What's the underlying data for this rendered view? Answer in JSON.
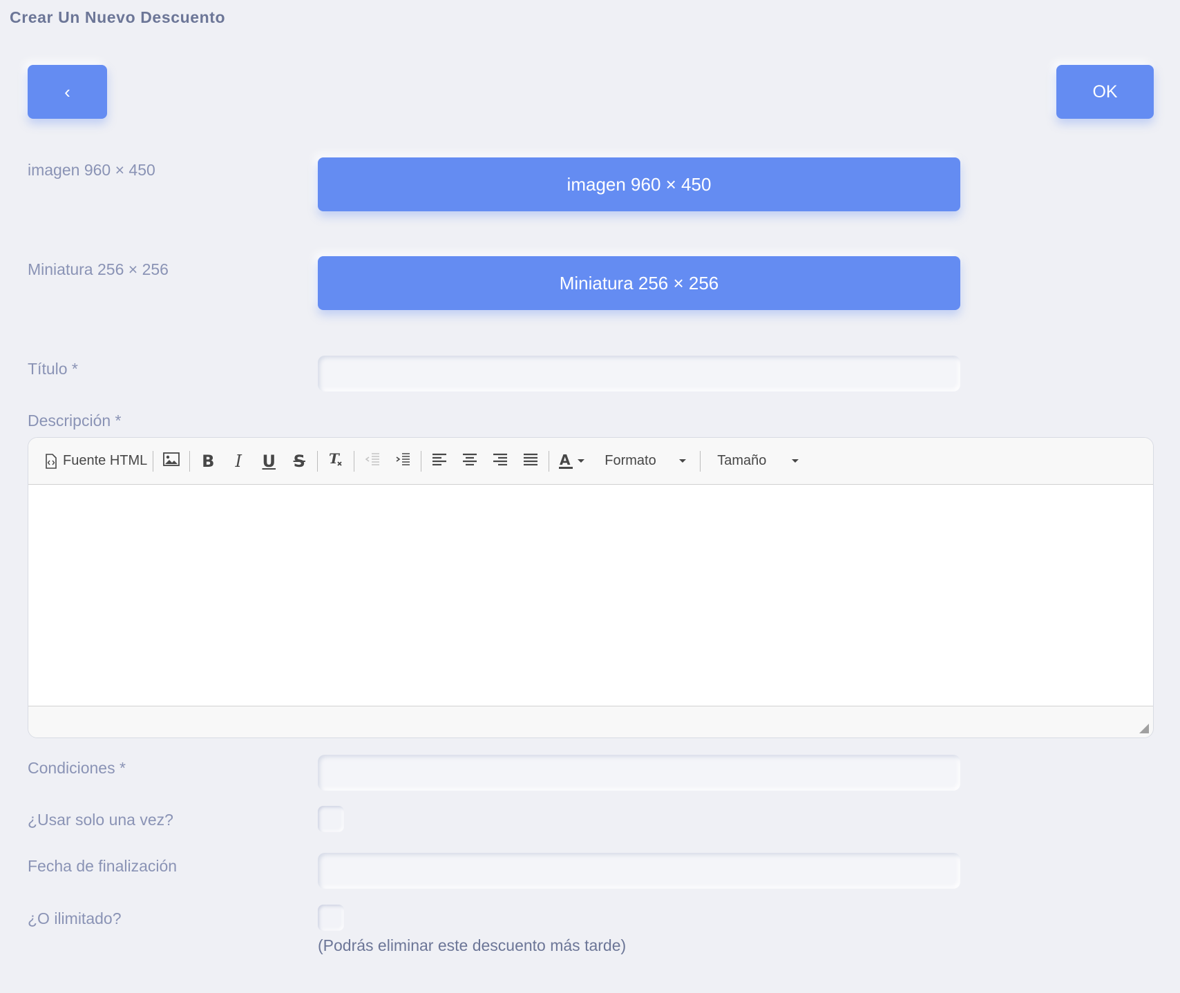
{
  "page": {
    "title": "Crear Un Nuevo Descuento"
  },
  "toolbar": {
    "back_label": "‹",
    "ok_label": "OK"
  },
  "image_field": {
    "label": "imagen 960 × 450",
    "button_label": "imagen 960 × 450"
  },
  "thumbnail_field": {
    "label": "Miniatura 256 × 256",
    "button_label": "Miniatura 256 × 256"
  },
  "title_field": {
    "label": "Título *",
    "value": ""
  },
  "description_field": {
    "label": "Descripción *",
    "editor": {
      "source_label": "Fuente HTML",
      "format_label": "Formato",
      "size_label": "Tamaño",
      "icons": [
        "source-icon",
        "image-icon",
        "bold-icon",
        "italic-icon",
        "underline-icon",
        "strikethrough-icon",
        "remove-format-icon",
        "outdent-icon",
        "indent-icon",
        "align-left-icon",
        "align-center-icon",
        "align-right-icon",
        "align-justify-icon",
        "text-color-icon"
      ]
    }
  },
  "conditions_field": {
    "label": "Condiciones *",
    "value": ""
  },
  "use_once_field": {
    "label": "¿Usar solo una vez?",
    "checked": false
  },
  "end_date_field": {
    "label": "Fecha de finalización",
    "value": ""
  },
  "unlimited_field": {
    "label": "¿O ilimitado?",
    "checked": false,
    "help_text": "(Podrás eliminar este descuento más tarde)"
  }
}
